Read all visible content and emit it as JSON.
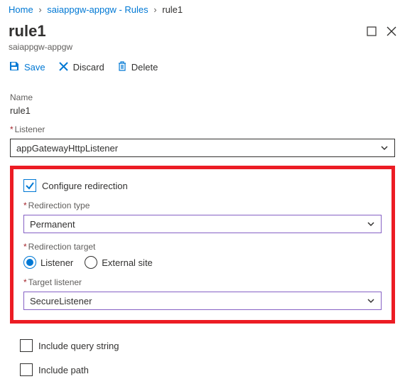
{
  "breadcrumb": {
    "home": "Home",
    "mid": "saiappgw-appgw - Rules",
    "current": "rule1"
  },
  "header": {
    "title": "rule1",
    "subtitle": "saiappgw-appgw"
  },
  "toolbar": {
    "save_label": "Save",
    "discard_label": "Discard",
    "delete_label": "Delete"
  },
  "fields": {
    "name_label": "Name",
    "name_value": "rule1",
    "listener_label": "Listener",
    "listener_value": "appGatewayHttpListener",
    "configure_redirection_label": "Configure redirection",
    "redirection_type_label": "Redirection type",
    "redirection_type_value": "Permanent",
    "redirection_target_label": "Redirection target",
    "target_option_listener": "Listener",
    "target_option_external": "External site",
    "target_listener_label": "Target listener",
    "target_listener_value": "SecureListener",
    "include_query_label": "Include query string",
    "include_path_label": "Include path"
  }
}
